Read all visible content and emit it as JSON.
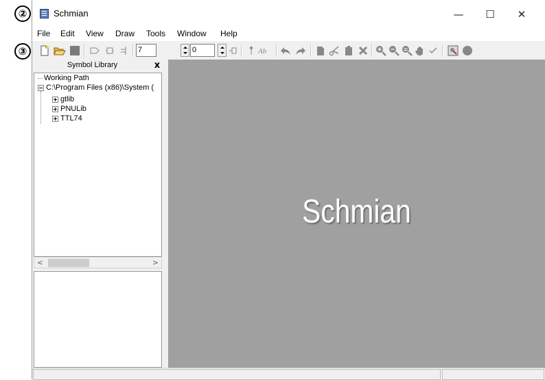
{
  "callouts": [
    "②",
    "③"
  ],
  "window": {
    "title": "Schmian",
    "minimize": "—",
    "maximize": "☐",
    "close": "✕"
  },
  "menu": [
    "File",
    "Edit",
    "View",
    "Draw",
    "Tools",
    "Window",
    "Help"
  ],
  "toolbar": {
    "spin1_value": "7",
    "spin2_value": "0",
    "buttons": [
      "new-file-icon",
      "open-folder-icon",
      "save-icon",
      "input-port-icon",
      "bidir-port-icon",
      "bus-entry-icon",
      "pin-icon",
      "text-icon",
      "undo-icon",
      "redo-icon",
      "copy-icon",
      "cut-icon",
      "paste-icon",
      "delete-icon",
      "zoom-in-icon",
      "zoom-out-icon",
      "zoom-fit-icon",
      "pan-hand-icon",
      "check-icon",
      "simulate-icon",
      "stop-icon"
    ]
  },
  "symbol_library": {
    "title": "Symbol Library",
    "close": "x",
    "tree": {
      "working_path": "Working Path",
      "root": "C:\\Program Files (x86)\\System (",
      "children": [
        "gtlib",
        "PNULib",
        "TTL74"
      ]
    }
  },
  "scroll": {
    "left": "<",
    "right": ">"
  },
  "canvas": {
    "splash": "Schmian",
    "color": "#a0a0a0"
  }
}
